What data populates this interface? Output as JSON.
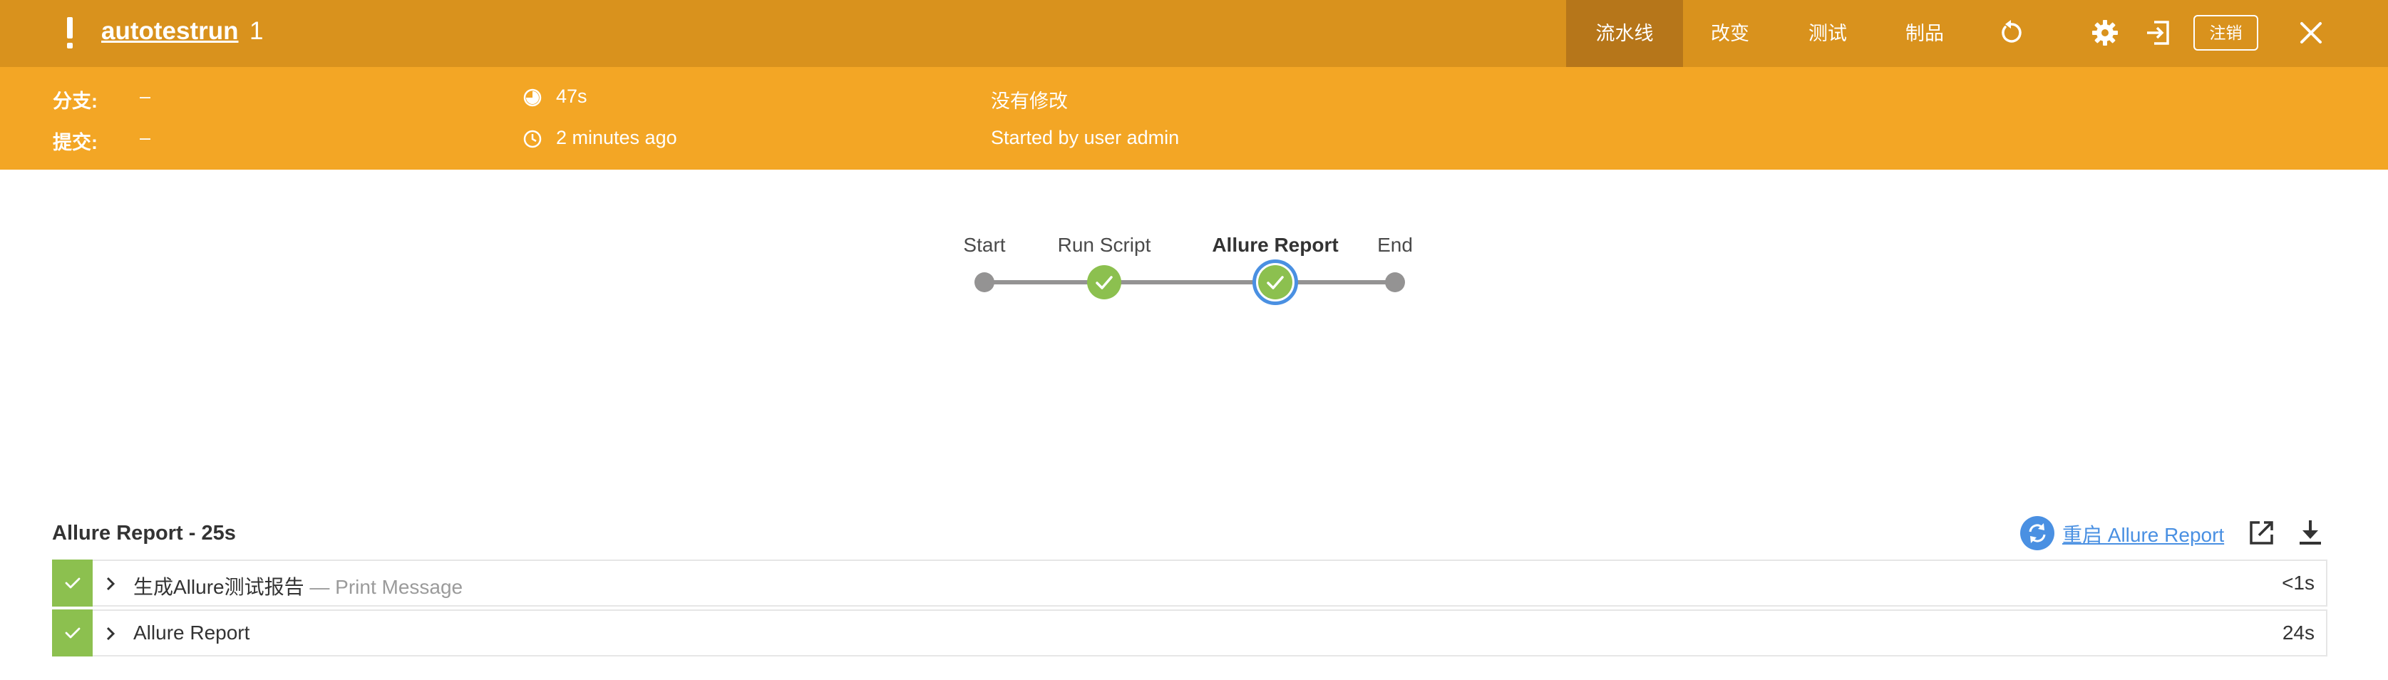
{
  "header": {
    "job_name": "autotestrun",
    "run_number": "1",
    "tabs": [
      {
        "label": "流水线",
        "active": true
      },
      {
        "label": "改变",
        "active": false
      },
      {
        "label": "测试",
        "active": false
      },
      {
        "label": "制品",
        "active": false
      }
    ],
    "icons": [
      "warning-icon",
      "replay-icon",
      "gear-icon",
      "exit-icon",
      "close-icon"
    ],
    "logout_label": "注销",
    "colors": {
      "header_bg": "#d9921d",
      "info_bg": "#f3a625",
      "active_tab": "#b6761a"
    }
  },
  "run_info": {
    "branch_label": "分支:",
    "branch_value": "–",
    "commit_label": "提交:",
    "commit_value": "–",
    "duration": "47s",
    "started_ago": "2 minutes ago",
    "changes": "没有修改",
    "cause": "Started by user admin"
  },
  "pipeline": {
    "stages": [
      {
        "name": "Start",
        "kind": "start"
      },
      {
        "name": "Run Script",
        "status": "success"
      },
      {
        "name": "Allure Report",
        "status": "success",
        "selected": true
      },
      {
        "name": "End",
        "kind": "end"
      }
    ],
    "colors": {
      "success": "#8cc04f",
      "selected_ring": "#4a90e2",
      "connector": "#949393"
    }
  },
  "stage_detail": {
    "title": "Allure Report - 25s",
    "restart_label": "重启 Allure Report",
    "steps": [
      {
        "name": "生成Allure测试报告",
        "subtitle": "— Print Message",
        "duration": "<1s",
        "status": "success"
      },
      {
        "name": "Allure Report",
        "subtitle": "",
        "duration": "24s",
        "status": "success"
      }
    ]
  }
}
